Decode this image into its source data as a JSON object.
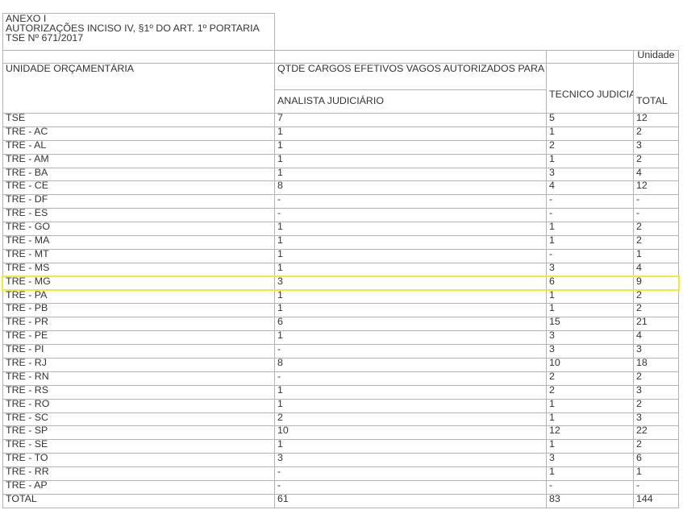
{
  "annex": {
    "title_lines": [
      "ANEXO I",
      "AUTORIZAÇÕES INCISO IV, §1º DO ART. 1º PORTARIA",
      "TSE Nº 671/2017"
    ],
    "unit_label": "Unidade"
  },
  "headers": {
    "unit": "UNIDADE ORÇAMENTÁRIA",
    "group": "QTDE CARGOS EFETIVOS VAGOS AUTORIZADOS PARA PROVIMENTO",
    "analista": "ANALISTA JUDICIÁRIO",
    "tecnico": "TÉCNICO JUDICIÁRIO",
    "total": "TOTAL"
  },
  "rows": [
    {
      "unit": "TSE",
      "analista": "7",
      "tecnico": "5",
      "total": "12"
    },
    {
      "unit": "TRE - AC",
      "analista": "1",
      "tecnico": "1",
      "total": "2"
    },
    {
      "unit": "TRE - AL",
      "analista": "1",
      "tecnico": "2",
      "total": "3"
    },
    {
      "unit": "TRE - AM",
      "analista": "1",
      "tecnico": "1",
      "total": "2"
    },
    {
      "unit": "TRE - BA",
      "analista": "1",
      "tecnico": "3",
      "total": "4"
    },
    {
      "unit": "TRE - CE",
      "analista": "8",
      "tecnico": "4",
      "total": "12"
    },
    {
      "unit": "TRE - DF",
      "analista": "-",
      "tecnico": "-",
      "total": "-"
    },
    {
      "unit": "TRE - ES",
      "analista": "-",
      "tecnico": "-",
      "total": "-"
    },
    {
      "unit": "TRE - GO",
      "analista": "1",
      "tecnico": "1",
      "total": "2"
    },
    {
      "unit": "TRE - MA",
      "analista": "1",
      "tecnico": "1",
      "total": "2"
    },
    {
      "unit": "TRE - MT",
      "analista": "1",
      "tecnico": "-",
      "total": "1"
    },
    {
      "unit": "TRE - MS",
      "analista": "1",
      "tecnico": "3",
      "total": "4"
    },
    {
      "unit": "TRE - MG",
      "analista": "3",
      "tecnico": "6",
      "total": "9"
    },
    {
      "unit": "TRE - PA",
      "analista": "1",
      "tecnico": "1",
      "total": "2"
    },
    {
      "unit": "TRE - PB",
      "analista": "1",
      "tecnico": "1",
      "total": "2"
    },
    {
      "unit": "TRE - PR",
      "analista": "6",
      "tecnico": "15",
      "total": "21"
    },
    {
      "unit": "TRE - PE",
      "analista": "1",
      "tecnico": "3",
      "total": "4"
    },
    {
      "unit": "TRE - PI",
      "analista": "-",
      "tecnico": "3",
      "total": "3"
    },
    {
      "unit": "TRE - RJ",
      "analista": "8",
      "tecnico": "10",
      "total": "18"
    },
    {
      "unit": "TRE - RN",
      "analista": "-",
      "tecnico": "2",
      "total": "2"
    },
    {
      "unit": "TRE - RS",
      "analista": "1",
      "tecnico": "2",
      "total": "3"
    },
    {
      "unit": "TRE - RO",
      "analista": "1",
      "tecnico": "1",
      "total": "2"
    },
    {
      "unit": "TRE - SC",
      "analista": "2",
      "tecnico": "1",
      "total": "3"
    },
    {
      "unit": "TRE - SP",
      "analista": "10",
      "tecnico": "12",
      "total": "22"
    },
    {
      "unit": "TRE - SE",
      "analista": "1",
      "tecnico": "1",
      "total": "2"
    },
    {
      "unit": "TRE - TO",
      "analista": "3",
      "tecnico": "3",
      "total": "6"
    },
    {
      "unit": "TRE - RR",
      "analista": "-",
      "tecnico": "1",
      "total": "1"
    },
    {
      "unit": "TRE - AP",
      "analista": "-",
      "tecnico": "-",
      "total": "-"
    }
  ],
  "totals": {
    "unit": "TOTAL",
    "analista": "61",
    "tecnico": "83",
    "total": "144"
  },
  "highlight": {
    "row_unit": "TRE - MG",
    "color": "#f2ea3a"
  }
}
